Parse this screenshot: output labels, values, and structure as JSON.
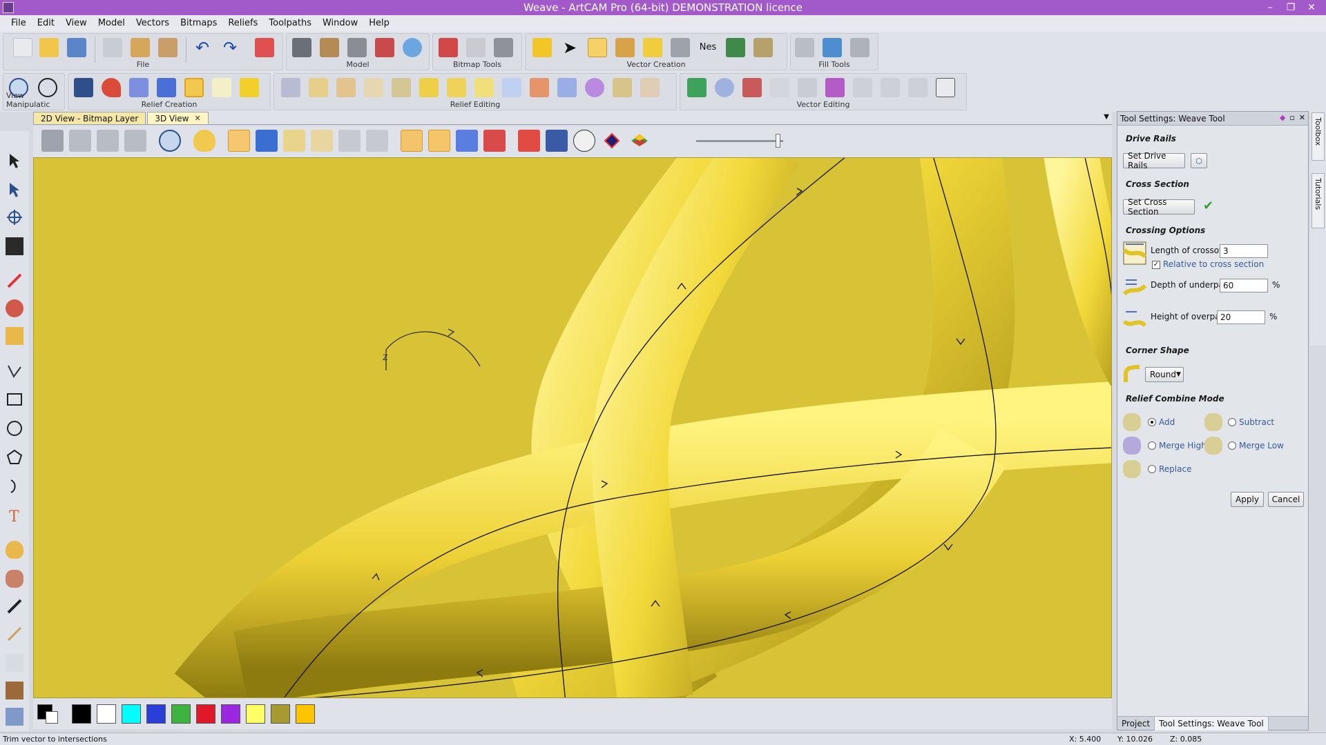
{
  "window": {
    "title": "Weave - ArtCAM Pro (64-bit) DEMONSTRATION licence",
    "buttons": [
      "–",
      "❐",
      "✕"
    ]
  },
  "menubar": [
    "File",
    "Edit",
    "View",
    "Model",
    "Vectors",
    "Bitmaps",
    "Reliefs",
    "Toolpaths",
    "Window",
    "Help"
  ],
  "toolbars": {
    "row1_groups": [
      "File",
      "Model",
      "Bitmap Tools",
      "Vector Creation",
      "Fill Tools"
    ],
    "row2_groups": [
      "View Manipulatic",
      "Relief Creation",
      "Relief Editing",
      "Vector Editing"
    ]
  },
  "doc_tabs": [
    {
      "label": "2D View - Bitmap Layer",
      "active": false
    },
    {
      "label": "3D View",
      "active": true,
      "close": "✕"
    }
  ],
  "viewport": {
    "background_color": "#d8c337",
    "axis_label": "Z"
  },
  "colorbar": {
    "swatches": [
      "#000000",
      "#ffffff",
      "#00ffff",
      "#2a3fd8",
      "#3fb33f",
      "#e0182a",
      "#9b28e0",
      "#ffff66",
      "#a89a32",
      "#ffc400"
    ]
  },
  "panel": {
    "title": "Tool Settings: Weave Tool",
    "drive_rails": {
      "heading": "Drive Rails",
      "button": "Set Drive Rails"
    },
    "cross_section": {
      "heading": "Cross Section",
      "button": "Set Cross Section",
      "check": "✔"
    },
    "crossing_options": {
      "heading": "Crossing Options",
      "length_label": "Length of crossover",
      "length_value": "3",
      "relative_label": "Relative to cross section",
      "relative_checked": true,
      "depth_label": "Depth of underpass",
      "depth_value": "60",
      "depth_unit": "%",
      "height_label": "Height of overpass",
      "height_value": "20",
      "height_unit": "%"
    },
    "corner_shape": {
      "heading": "Corner Shape",
      "value": "Round"
    },
    "relief_combine": {
      "heading": "Relief Combine Mode",
      "options": [
        "Add",
        "Subtract",
        "Merge High",
        "Merge Low",
        "Replace"
      ],
      "selected": "Add"
    },
    "apply": "Apply",
    "cancel": "Cancel",
    "footer_tabs": [
      "Project",
      "Tool Settings: Weave Tool"
    ]
  },
  "side_tabs": [
    "Toolbox",
    "Tutorials"
  ],
  "statusbar": {
    "message": "Trim vector to intersections",
    "x": "X: 5.400",
    "y": "Y: 10.026",
    "z": "Z: 0.085"
  }
}
